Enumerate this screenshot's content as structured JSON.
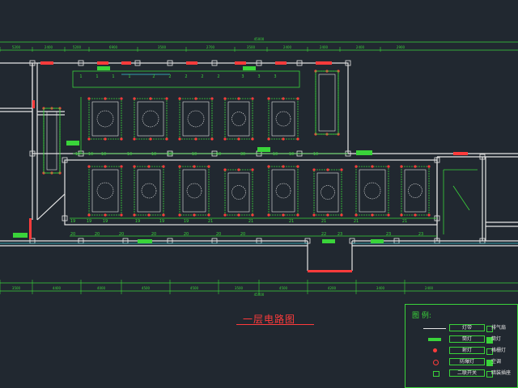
{
  "title": "一层电路图",
  "legend": {
    "heading": "图 例:",
    "rows": [
      {
        "label": "灯带",
        "symbol": "line",
        "label2": "排气扇",
        "color": "#e6e6e6"
      },
      {
        "label": "筒灯",
        "symbol": "green-bar",
        "label2": "筒灯",
        "color": "#3ad43a"
      },
      {
        "label": "射灯",
        "symbol": "red-dot",
        "label2": "格栅灯",
        "color": "#ff3b3b"
      },
      {
        "label": "防爆灯",
        "symbol": "red-circle",
        "label2": "空调",
        "color": "#ff3b3b"
      },
      {
        "label": "二联开关",
        "symbol": "green-box",
        "label2": "暗装插座",
        "color": "#3ad43a"
      }
    ]
  },
  "dims_top": [
    "5200",
    "2400",
    "5200",
    "6900",
    "3500",
    "2700",
    "3500",
    "2400",
    "2400",
    "2400",
    "2900"
  ],
  "dims_bottom": [
    "3500",
    "4400",
    "4000",
    "4500",
    "4500",
    "3500",
    "4500",
    "4200",
    "3400",
    "2400"
  ],
  "total_top": "45000",
  "total_bottom": "45000",
  "room_numbers_row1": [
    "1",
    "1",
    "1",
    "1",
    "2",
    "2",
    "2",
    "2",
    "2",
    "3",
    "3",
    "3"
  ],
  "room_numbers_row2": [
    "10",
    "10",
    "10",
    "10",
    "10",
    "10",
    "10",
    "10",
    "30",
    "10",
    "10",
    "10"
  ],
  "room_numbers_row3": [
    "19",
    "19",
    "19",
    "19",
    "19",
    "19",
    "21",
    "21",
    "21",
    "21",
    "21",
    "21"
  ],
  "room_numbers_row4": [
    "20",
    "20",
    "20",
    "20",
    "20",
    "20",
    "20",
    "22",
    "23",
    "23",
    "23"
  ]
}
